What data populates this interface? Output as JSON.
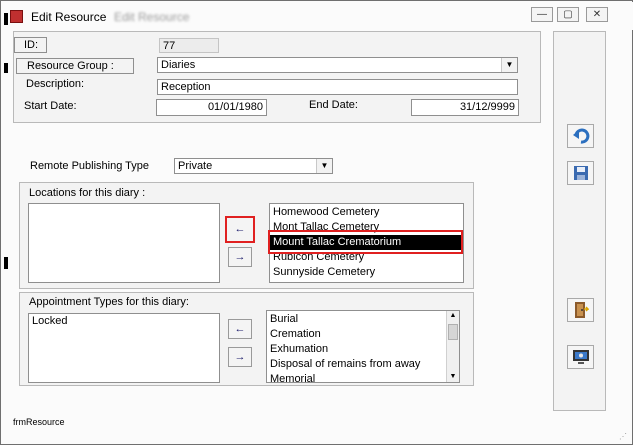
{
  "window": {
    "title": "Edit Resource",
    "ghost_title": "Edit Resource"
  },
  "form": {
    "id_label": "ID:",
    "id_value": "77",
    "group_label": "Resource Group :",
    "group_value": "Diaries",
    "desc_label": "Description:",
    "desc_value": "Reception",
    "start_label": "Start Date:",
    "start_value": "01/01/1980",
    "end_label": "End Date:",
    "end_value": "31/12/9999",
    "publish_label": "Remote Publishing Type",
    "publish_value": "Private"
  },
  "locations": {
    "label": "Locations for this diary :",
    "selected_items": [],
    "available_items": [
      "Homewood Cemetery",
      "Mont Tallac Cemetery",
      "Mount Tallac Crematorium",
      "Rubicon Cemetery",
      "Sunnyside Cemetery"
    ],
    "highlighted": "Mount Tallac Crematorium"
  },
  "appointments": {
    "label": "Appointment Types for this diary:",
    "selected_items": [
      "Locked"
    ],
    "available_items": [
      "Burial",
      "Cremation",
      "Exhumation",
      "Disposal of remains from away",
      "Memorial"
    ]
  },
  "arrows": {
    "left": "←",
    "right": "→"
  },
  "side_icons": [
    "undo-icon",
    "save-icon",
    "exit-door-icon",
    "monitor-icon"
  ],
  "status": {
    "form_name": "frmResource"
  }
}
